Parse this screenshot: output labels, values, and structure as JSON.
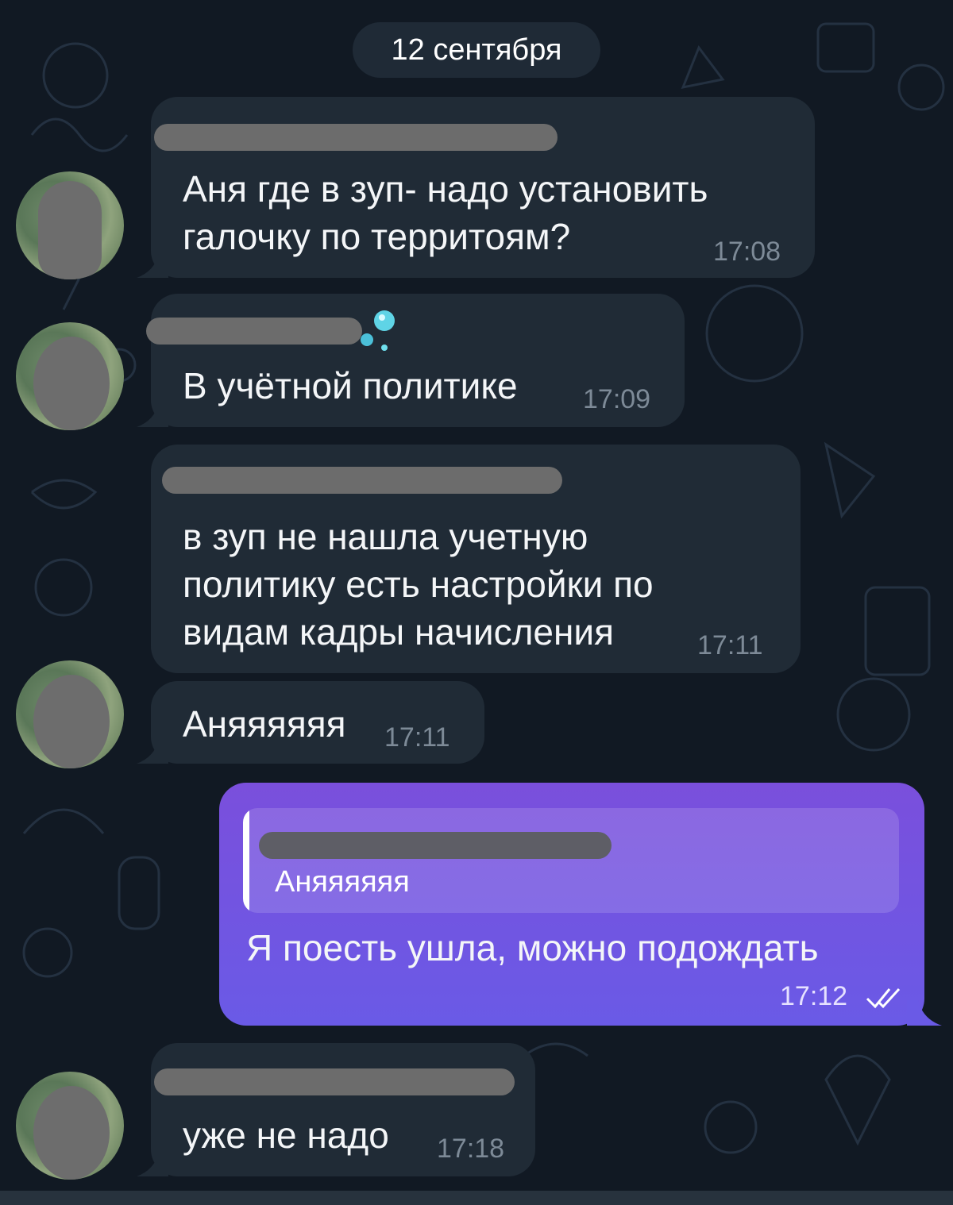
{
  "chat": {
    "date_separator": "12 сентября",
    "messages": [
      {
        "text": "Аня где в зуп- надо установить\nгалочку по территоям?",
        "time": "17:08"
      },
      {
        "text": "В учётной политике",
        "time": "17:09"
      },
      {
        "text": "в зуп не нашла учетную\nполитику есть настройки по\nвидам кадры начисления",
        "time": "17:11"
      },
      {
        "text": "Аняяяяяя",
        "time": "17:11"
      },
      {
        "reply_text": "Аняяяяяя",
        "text": "Я поесть ушла, можно подождать",
        "time": "17:12"
      },
      {
        "text": "уже не надо",
        "time": "17:18"
      }
    ]
  },
  "colors": {
    "background": "#111923",
    "incoming_bubble": "#202b36",
    "outgoing_bubble": "#6a5ae6",
    "timestamp": "#7d8a97"
  },
  "icons": [
    "read-double-check-icon",
    "bubble-emoji-icon"
  ]
}
